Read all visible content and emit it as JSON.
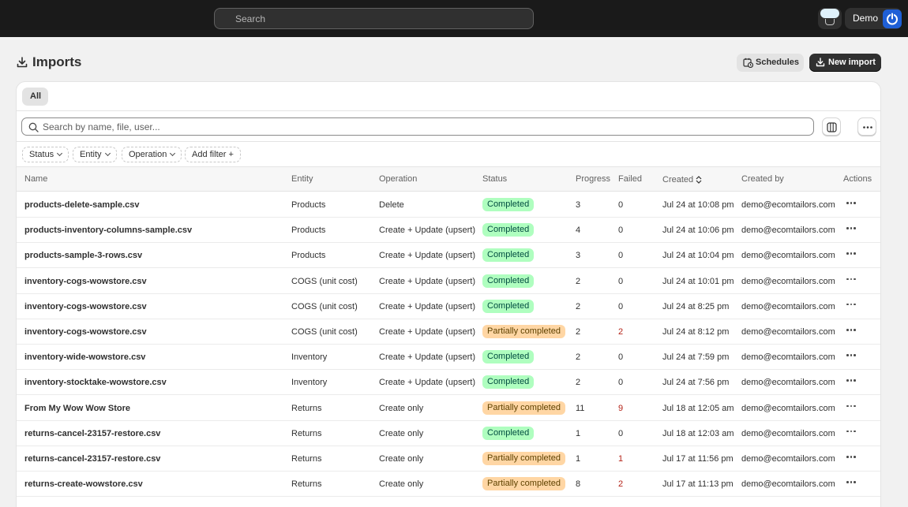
{
  "topbar": {
    "search_placeholder": "Search",
    "user_name": "Demo"
  },
  "header": {
    "title": "Imports",
    "schedules_label": "Schedules",
    "new_import_label": "New import"
  },
  "tabs": [
    {
      "label": "All"
    }
  ],
  "search": {
    "placeholder": "Search by name, file, user..."
  },
  "filters": [
    {
      "label": "Status"
    },
    {
      "label": "Entity"
    },
    {
      "label": "Operation"
    },
    {
      "label": "Add filter +"
    }
  ],
  "columns": {
    "name": "Name",
    "entity": "Entity",
    "operation": "Operation",
    "status": "Status",
    "progress": "Progress",
    "failed": "Failed",
    "created": "Created",
    "created_by": "Created by",
    "actions": "Actions"
  },
  "rows": [
    {
      "name": "products-delete-sample.csv",
      "entity": "Products",
      "operation": "Delete",
      "status": "Completed",
      "status_type": "ok",
      "progress": "3",
      "failed": "0",
      "created": "Jul 24 at 10:08 pm",
      "created_by": "demo@ecomtailors.com"
    },
    {
      "name": "products-inventory-columns-sample.csv",
      "entity": "Products",
      "operation": "Create + Update (upsert)",
      "status": "Completed",
      "status_type": "ok",
      "progress": "4",
      "failed": "0",
      "created": "Jul 24 at 10:06 pm",
      "created_by": "demo@ecomtailors.com"
    },
    {
      "name": "products-sample-3-rows.csv",
      "entity": "Products",
      "operation": "Create + Update (upsert)",
      "status": "Completed",
      "status_type": "ok",
      "progress": "3",
      "failed": "0",
      "created": "Jul 24 at 10:04 pm",
      "created_by": "demo@ecomtailors.com"
    },
    {
      "name": "inventory-cogs-wowstore.csv",
      "entity": "COGS (unit cost)",
      "operation": "Create + Update (upsert)",
      "status": "Completed",
      "status_type": "ok",
      "progress": "2",
      "failed": "0",
      "created": "Jul 24 at 10:01 pm",
      "created_by": "demo@ecomtailors.com"
    },
    {
      "name": "inventory-cogs-wowstore.csv",
      "entity": "COGS (unit cost)",
      "operation": "Create + Update (upsert)",
      "status": "Completed",
      "status_type": "ok",
      "progress": "2",
      "failed": "0",
      "created": "Jul 24 at 8:25 pm",
      "created_by": "demo@ecomtailors.com"
    },
    {
      "name": "inventory-cogs-wowstore.csv",
      "entity": "COGS (unit cost)",
      "operation": "Create + Update (upsert)",
      "status": "Partially completed",
      "status_type": "partial",
      "progress": "2",
      "failed": "2",
      "created": "Jul 24 at 8:12 pm",
      "created_by": "demo@ecomtailors.com"
    },
    {
      "name": "inventory-wide-wowstore.csv",
      "entity": "Inventory",
      "operation": "Create + Update (upsert)",
      "status": "Completed",
      "status_type": "ok",
      "progress": "2",
      "failed": "0",
      "created": "Jul 24 at 7:59 pm",
      "created_by": "demo@ecomtailors.com"
    },
    {
      "name": "inventory-stocktake-wowstore.csv",
      "entity": "Inventory",
      "operation": "Create + Update (upsert)",
      "status": "Completed",
      "status_type": "ok",
      "progress": "2",
      "failed": "0",
      "created": "Jul 24 at 7:56 pm",
      "created_by": "demo@ecomtailors.com"
    },
    {
      "name": "From My Wow Wow Store",
      "entity": "Returns",
      "operation": "Create only",
      "status": "Partially completed",
      "status_type": "partial",
      "progress": "11",
      "failed": "9",
      "created": "Jul 18 at 12:05 am",
      "created_by": "demo@ecomtailors.com"
    },
    {
      "name": "returns-cancel-23157-restore.csv",
      "entity": "Returns",
      "operation": "Create only",
      "status": "Completed",
      "status_type": "ok",
      "progress": "1",
      "failed": "0",
      "created": "Jul 18 at 12:03 am",
      "created_by": "demo@ecomtailors.com"
    },
    {
      "name": "returns-cancel-23157-restore.csv",
      "entity": "Returns",
      "operation": "Create only",
      "status": "Partially completed",
      "status_type": "partial",
      "progress": "1",
      "failed": "1",
      "created": "Jul 17 at 11:56 pm",
      "created_by": "demo@ecomtailors.com"
    },
    {
      "name": "returns-create-wowstore.csv",
      "entity": "Returns",
      "operation": "Create only",
      "status": "Partially completed",
      "status_type": "partial",
      "progress": "8",
      "failed": "2",
      "created": "Jul 17 at 11:13 pm",
      "created_by": "demo@ecomtailors.com"
    }
  ]
}
